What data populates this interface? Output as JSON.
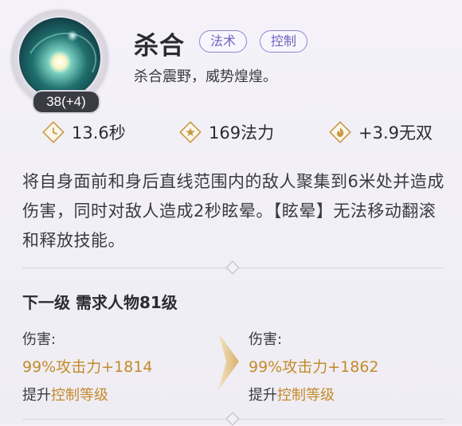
{
  "skill": {
    "name": "杀合",
    "tags": [
      "法术",
      "控制"
    ],
    "subtitle": "杀合震野，威势煌煌。",
    "level_badge": "38(+4)",
    "icon": "swirling-star-skill-icon"
  },
  "stats": {
    "cooldown": "13.6秒",
    "cost": "169法力",
    "wushuang": "+3.9无双"
  },
  "description": "将自身面前和身后直线范围内的敌人聚集到6米处并造成伤害，同时对敌人造成2秒眩晕。【眩晕】无法移动翻滚和释放技能。",
  "next_level": {
    "title": "下一级 需求人物81级",
    "current": {
      "label": "伤害:",
      "value": "99%攻击力+1814",
      "upgrade_prefix": "提升",
      "upgrade_highlight": "控制等级"
    },
    "next": {
      "label": "伤害:",
      "value": "99%攻击力+1862",
      "upgrade_prefix": "提升",
      "upgrade_highlight": "控制等级"
    }
  },
  "colors": {
    "accent_gold": "#c48a2a",
    "tag_purple": "#6e63bd"
  }
}
